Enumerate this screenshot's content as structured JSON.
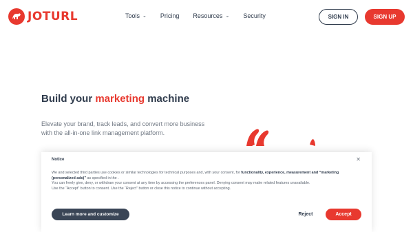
{
  "brand": {
    "logo_text": "JOTURL",
    "accent_color": "#e8392f",
    "dark_color": "#2f3b4c"
  },
  "nav": {
    "items": [
      {
        "label": "Tools",
        "has_dropdown": true,
        "icon": "chevron-down-icon"
      },
      {
        "label": "Pricing",
        "has_dropdown": false
      },
      {
        "label": "Resources",
        "has_dropdown": true,
        "icon": "chevron-down-icon"
      },
      {
        "label": "Security",
        "has_dropdown": false
      }
    ],
    "signin_label": "SIGN IN",
    "signup_label": "SIGN UP"
  },
  "hero": {
    "title_before": "Build your ",
    "title_accent": "marketing",
    "title_after": " machine",
    "subtitle": "Elevate your brand, track leads, and convert more business with the all-in-one link management platform."
  },
  "notice": {
    "title": "Notice",
    "close_icon": "close-icon",
    "p1_before": "We and selected third parties use cookies or similar technologies for technical purposes and, with your consent, for ",
    "p1_bold": "functionality, experience, measurement and “marketing (personalized ads)”",
    "p1_after": " as specified in the .",
    "p2": "You can freely give, deny, or withdraw your consent at any time by accessing the preferences panel. Denying consent may make related features unavailable.",
    "p3": "Use the “Accept” button to consent. Use the “Reject” button or close this notice to continue without accepting.",
    "learn_label": "Learn more and customize",
    "reject_label": "Reject",
    "accept_label": "Accept"
  }
}
